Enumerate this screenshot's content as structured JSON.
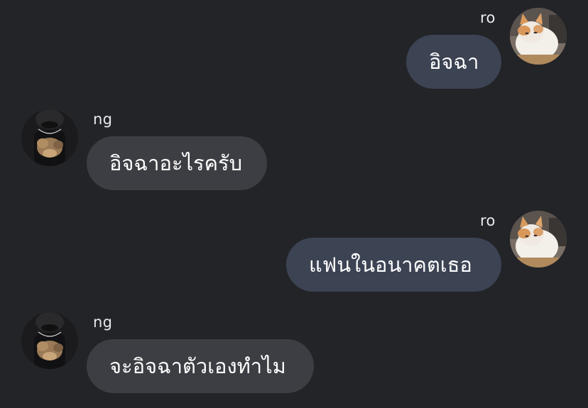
{
  "conversation": {
    "messages": [
      {
        "sender": "ro",
        "text": "อิจฉา"
      },
      {
        "sender": "ng",
        "text": "อิจฉาอะไรครับ"
      },
      {
        "sender": "ro",
        "text": "แฟนในอนาคตเธอ"
      },
      {
        "sender": "ng",
        "text": "จะอิจฉาตัวเองทำไม"
      }
    ]
  },
  "colors": {
    "background": "#232428",
    "outgoing_bubble": "#3c4353",
    "incoming_bubble": "#3d3e43",
    "text": "#ffffff"
  },
  "icons": {
    "ro_avatar": "cat-avatar-icon",
    "ng_avatar": "person-holding-cat-avatar-icon"
  }
}
